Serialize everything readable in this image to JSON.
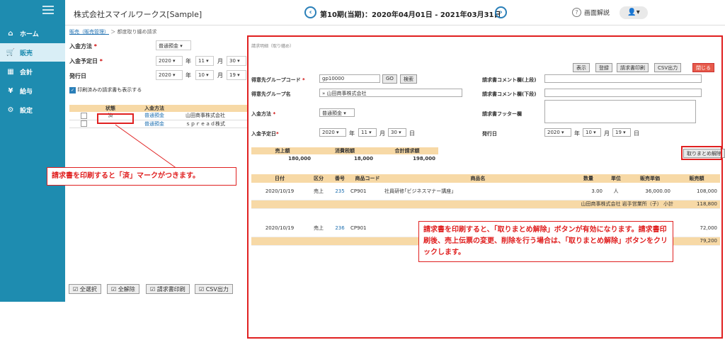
{
  "sidebar": {
    "items": [
      {
        "label": "ホーム",
        "icon": "home-icon"
      },
      {
        "label": "販売",
        "icon": "cart-icon"
      },
      {
        "label": "会計",
        "icon": "calculator-icon"
      },
      {
        "label": "給与",
        "icon": "money-bag-icon"
      },
      {
        "label": "設定",
        "icon": "gear-icon"
      }
    ],
    "active": "販売"
  },
  "header": {
    "company": "株式会社スマイルワークス[Sample]",
    "period": "第10期(当期)：2020年04月01日 - 2021年03月31日",
    "prev": "‹",
    "next": "›",
    "help": "画面解説",
    "user_icon": "user-icon"
  },
  "bg": {
    "breadcrumb_link": "販売（販売管理）",
    "breadcrumb_rest": "＞ 都度取り纏め請求",
    "deposit_method_label": "入金方法",
    "deposit_method_value": "普通預金",
    "deposit_date_label": "入金予定日",
    "issue_date_label": "発行日",
    "date1": {
      "y": "2020",
      "m": "11",
      "d": "30"
    },
    "date2": {
      "y": "2020",
      "m": "10",
      "d": "19"
    },
    "year_unit": "年",
    "month_unit": "月",
    "show_printed_label": "印刷済みの請求書も表示する",
    "table_headers": [
      "",
      "状態",
      "入金方法",
      ""
    ],
    "rows": [
      {
        "status": "済",
        "method": "普通預金",
        "customer": "山田商事株式会社"
      },
      {
        "status": "",
        "method": "普通預金",
        "customer": "ｓｐｒｅａｄ株式"
      }
    ],
    "buttons": [
      "全選択",
      "全解除",
      "請求書印刷",
      "CSV出力"
    ]
  },
  "annotations": {
    "left": "請求書を印刷すると「済」マークがつきます。",
    "right": "請求書を印刷すると、「取りまとめ解除」ボタンが有効になります。請求書印刷後、売上伝票の変更、削除を行う場合は、「取りまとめ解除」ボタンをクリックします。"
  },
  "panel": {
    "title": "請求明細（取り纏め）",
    "buttons": [
      "表示",
      "登録",
      "請求書印刷",
      "CSV出力"
    ],
    "close": "閉じる",
    "group_code_label": "得意先グループコード",
    "group_code": "gp10000",
    "go": "GO",
    "search": "検索",
    "group_name_label": "得意先グループ名",
    "group_name": "» 山田商事株式会社",
    "method_label": "入金方法",
    "method": "普通預金",
    "due_label": "入金予定日",
    "due": {
      "y": "2020",
      "m": "11",
      "d": "30",
      "d_unit": "日"
    },
    "comment_top_label": "請求書コメント欄(上段)",
    "comment_bottom_label": "請求書コメント欄(下段)",
    "footer_label": "請求書フッター欄",
    "issue_label": "発行日",
    "issue": {
      "y": "2020",
      "m": "10",
      "d": "19",
      "d_unit": "日"
    },
    "unbundle": "取りまとめ解除",
    "summary": {
      "headers": [
        "売上額",
        "消費税額",
        "合計請求額"
      ],
      "values": [
        "180,000",
        "18,000",
        "198,000"
      ]
    },
    "detail_headers": [
      "日付",
      "区分",
      "番号",
      "商品コード",
      "商品名",
      "数量",
      "単位",
      "販売単価",
      "販売額"
    ],
    "detail": [
      {
        "date": "2020/10/19",
        "type": "売上",
        "no": "235",
        "code": "CP901",
        "name": "社員研修｢ビジネスマナー講座｣",
        "qty": "3.00",
        "unit": "人",
        "price": "36,000.00",
        "amount": "108,000"
      },
      {
        "subtotal_label": "山田商事株式会社 岩手営業所（子） 小計",
        "subtotal": "118,800"
      },
      {
        "date": "2020/10/19",
        "type": "売上",
        "no": "236",
        "code": "CP901",
        "name": "",
        "qty": "",
        "unit": "",
        "price": "",
        "amount": "72,000"
      },
      {
        "subtotal_label": "",
        "subtotal": "79,200"
      }
    ]
  }
}
